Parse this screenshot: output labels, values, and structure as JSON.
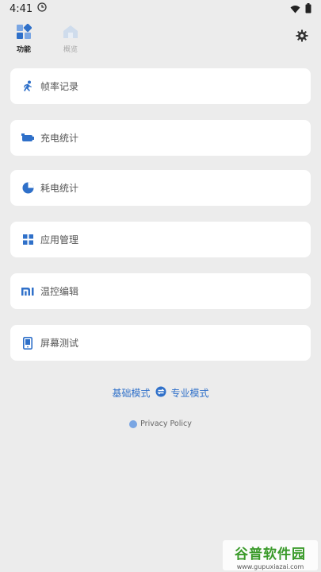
{
  "status_bar": {
    "time": "4:41",
    "icons": [
      "clock-icon",
      "wifi-icon",
      "battery-icon"
    ]
  },
  "top_tabs": [
    {
      "label": "功能",
      "icon": "dashboard-icon",
      "active": true
    },
    {
      "label": "概览",
      "icon": "house-icon",
      "active": false
    }
  ],
  "settings_icon": "gear-icon",
  "menu": [
    {
      "label": "帧率记录",
      "icon": "running-icon"
    },
    {
      "label": "充电统计",
      "icon": "battery-charge-icon"
    },
    {
      "label": "耗电统计",
      "icon": "pie-chart-icon"
    },
    {
      "label": "应用管理",
      "icon": "grid-icon"
    },
    {
      "label": "温控编辑",
      "icon": "mi-logo-icon"
    },
    {
      "label": "屏幕测试",
      "icon": "phone-screen-icon"
    }
  ],
  "mode_switch": {
    "left": "基础模式",
    "right": "专业模式",
    "icon": "switch-icon"
  },
  "privacy": {
    "label": "Privacy Policy"
  },
  "watermark": {
    "brand": "谷普软件园",
    "url": "www.gupuxiazai.com"
  },
  "colors": {
    "accent": "#2f70c9",
    "background": "#ececec",
    "card": "#ffffff"
  }
}
